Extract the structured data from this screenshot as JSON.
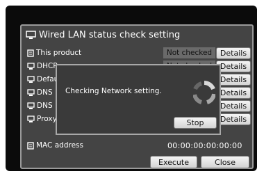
{
  "window": {
    "title": "Wired LAN status check setting",
    "title_icon": "network-monitor-icon"
  },
  "rows": [
    {
      "label": "This product",
      "icon": "device-icon",
      "status": "Not checked",
      "button": "Details"
    },
    {
      "label": "DHCP",
      "icon": "network-monitor-icon",
      "status": "Not checked",
      "button": "Details"
    },
    {
      "label": "Default Gateway",
      "icon": "network-monitor-icon",
      "status": "",
      "button": "Details"
    },
    {
      "label": "DNS",
      "icon": "network-monitor-icon",
      "status": "",
      "button": "Details"
    },
    {
      "label": "DNS",
      "icon": "network-monitor-icon",
      "status": "",
      "button": "Details"
    },
    {
      "label": "Proxy",
      "icon": "network-monitor-icon",
      "status": "",
      "button": "Details"
    }
  ],
  "mac": {
    "label": "MAC address",
    "value": "00:00:00:00:00:00"
  },
  "actions": {
    "execute": "Execute",
    "close": "Close"
  },
  "dialog": {
    "message": "Checking Network setting.",
    "stop": "Stop"
  },
  "colors": {
    "panel": "#444444",
    "status_bg": "#6a6a6a",
    "dialog_bg": "#3a3a3a"
  }
}
